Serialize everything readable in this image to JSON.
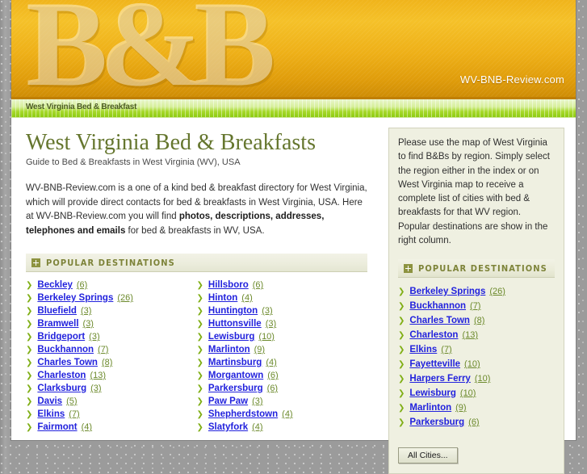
{
  "masthead": {
    "logo_text": "B&B",
    "domain": "WV-BNB-Review.com"
  },
  "navbar": {
    "breadcrumb": "West Virginia Bed & Breakfast"
  },
  "main": {
    "title": "West Virginia Bed & Breakfasts",
    "subtitle": "Guide to Bed & Breakfasts in West Virginia (WV), USA",
    "intro_part1": "WV-BNB-Review.com is a one of a kind bed & breakfast directory for West Virginia, which will provide direct contacts for bed & breakfasts in West Virginia, USA. Here at WV-BNB-Review.com you will find ",
    "intro_bold": "photos, descriptions, addresses, telephones and emails",
    "intro_part2": " for bed & breakfasts in WV, USA.",
    "section_title": "POPULAR DESTINATIONS",
    "cities_left": [
      {
        "name": "Beckley",
        "count": "(6)"
      },
      {
        "name": "Berkeley Springs",
        "count": "(26)"
      },
      {
        "name": "Bluefield",
        "count": "(3)"
      },
      {
        "name": "Bramwell",
        "count": "(3)"
      },
      {
        "name": "Bridgeport",
        "count": "(3)"
      },
      {
        "name": "Buckhannon",
        "count": "(7)"
      },
      {
        "name": "Charles Town",
        "count": "(8)"
      },
      {
        "name": "Charleston",
        "count": "(13)"
      },
      {
        "name": "Clarksburg",
        "count": "(3)"
      },
      {
        "name": "Davis",
        "count": "(5)"
      },
      {
        "name": "Elkins",
        "count": "(7)"
      },
      {
        "name": "Fairmont",
        "count": "(4)"
      }
    ],
    "cities_right": [
      {
        "name": "Hillsboro",
        "count": "(6)"
      },
      {
        "name": "Hinton",
        "count": "(4)"
      },
      {
        "name": "Huntington",
        "count": "(3)"
      },
      {
        "name": "Huttonsville",
        "count": "(3)"
      },
      {
        "name": "Lewisburg",
        "count": "(10)"
      },
      {
        "name": "Marlinton",
        "count": "(9)"
      },
      {
        "name": "Martinsburg",
        "count": "(4)"
      },
      {
        "name": "Morgantown",
        "count": "(6)"
      },
      {
        "name": "Parkersburg",
        "count": "(6)"
      },
      {
        "name": "Paw Paw",
        "count": "(3)"
      },
      {
        "name": "Shepherdstown",
        "count": "(4)"
      },
      {
        "name": "Slatyfork",
        "count": "(4)"
      }
    ]
  },
  "sidebar": {
    "intro": "Please use the map of West Virginia to find B&Bs by region. Simply select the region either in the index or on West Virginia map to receive a complete list of cities with bed & breakfasts for that WV region. Popular destinations are show in the right column.",
    "section_title": "POPULAR DESTINATIONS",
    "cities": [
      {
        "name": "Berkeley Springs",
        "count": "(26)"
      },
      {
        "name": "Buckhannon",
        "count": "(7)"
      },
      {
        "name": "Charles Town",
        "count": "(8)"
      },
      {
        "name": "Charleston",
        "count": "(13)"
      },
      {
        "name": "Elkins",
        "count": "(7)"
      },
      {
        "name": "Fayetteville",
        "count": "(10)"
      },
      {
        "name": "Harpers Ferry",
        "count": "(10)"
      },
      {
        "name": "Lewisburg",
        "count": "(10)"
      },
      {
        "name": "Marlinton",
        "count": "(9)"
      },
      {
        "name": "Parkersburg",
        "count": "(6)"
      }
    ],
    "all_cities_label": "All Cities..."
  },
  "icons": {
    "arrow": "❯",
    "plus": "plus-icon"
  },
  "colors": {
    "header_gold": "#eeb018",
    "nav_green": "#a7d92b",
    "title_olive": "#65762e",
    "link_blue": "#2222dd",
    "count_green": "#6c8a2c",
    "sidebar_bg": "#eff0e1"
  }
}
